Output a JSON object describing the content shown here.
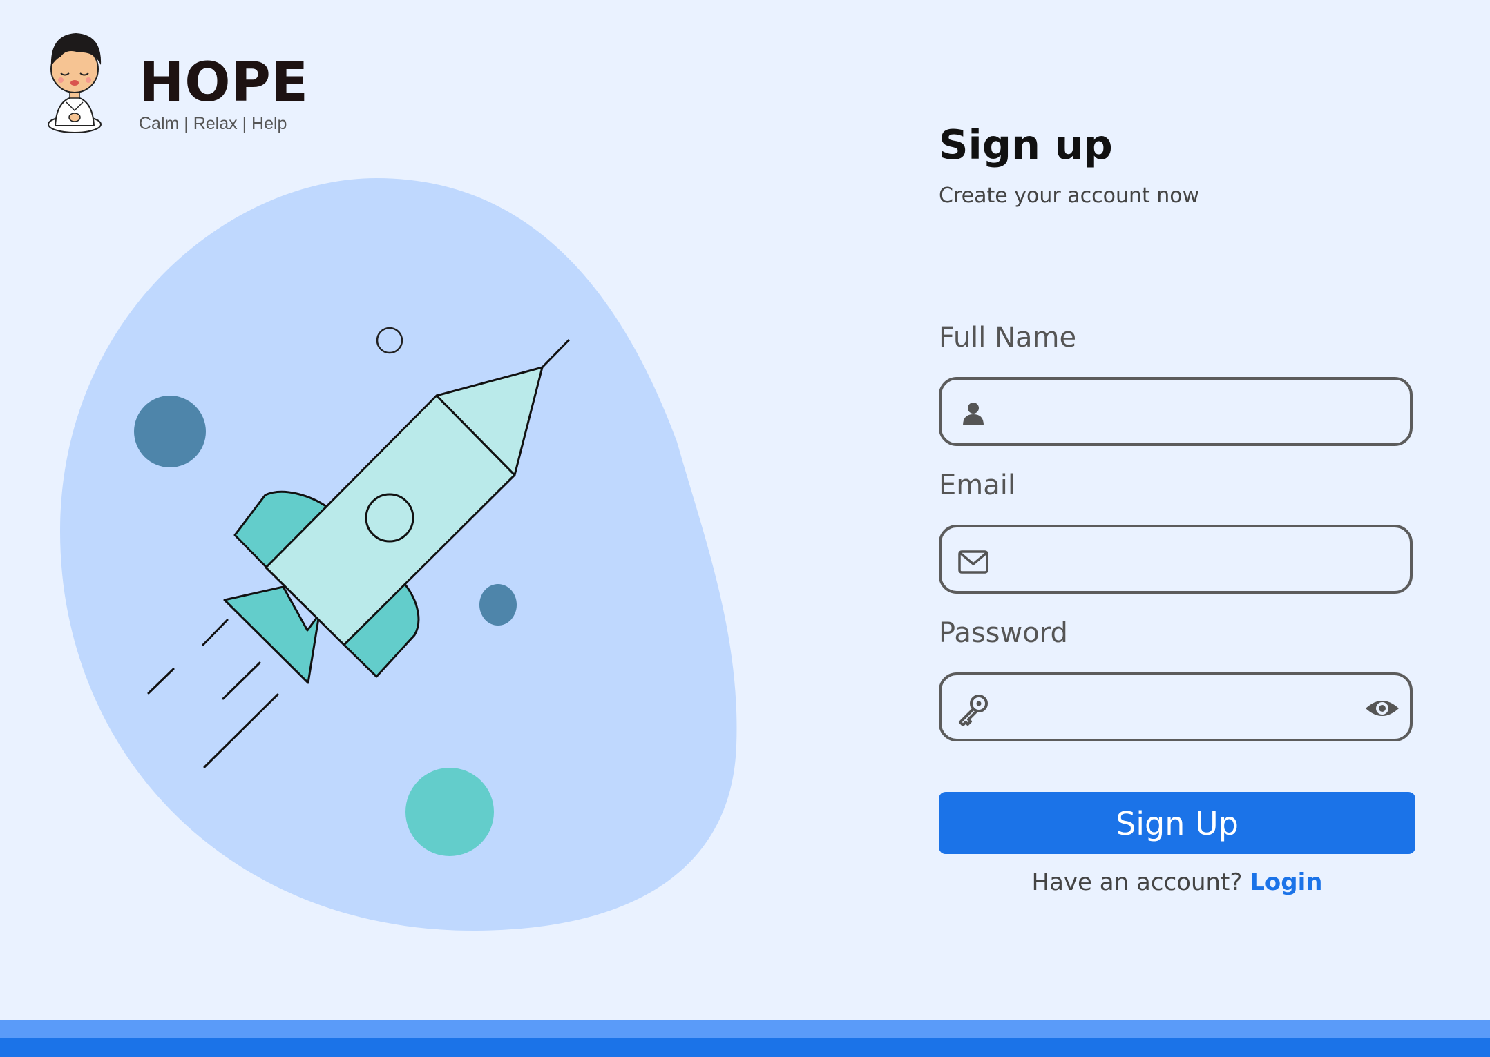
{
  "brand": {
    "name": "HOPE",
    "tagline": "Calm | Relax | Help"
  },
  "signup": {
    "title": "Sign up",
    "subtitle": "Create your account now",
    "fields": {
      "full_name": {
        "label": "Full Name",
        "value": "",
        "icon": "user-icon"
      },
      "email": {
        "label": "Email",
        "value": "",
        "icon": "envelope-icon"
      },
      "password": {
        "label": "Password",
        "value": "",
        "icon": "key-icon",
        "toggle_icon": "eye-icon"
      }
    },
    "submit_label": "Sign Up",
    "login_prompt": "Have an account?",
    "login_link": "Login"
  },
  "illustration": {
    "subject": "rocket-illustration"
  },
  "colors": {
    "background": "#EAF2FF",
    "blob": "#BFD8FE",
    "accent": "#1B73E8",
    "accent_light": "#5A9BF9",
    "teal": "#63CDCB",
    "teal_light": "#BAEAEA",
    "steel_blue": "#4E85AA"
  }
}
